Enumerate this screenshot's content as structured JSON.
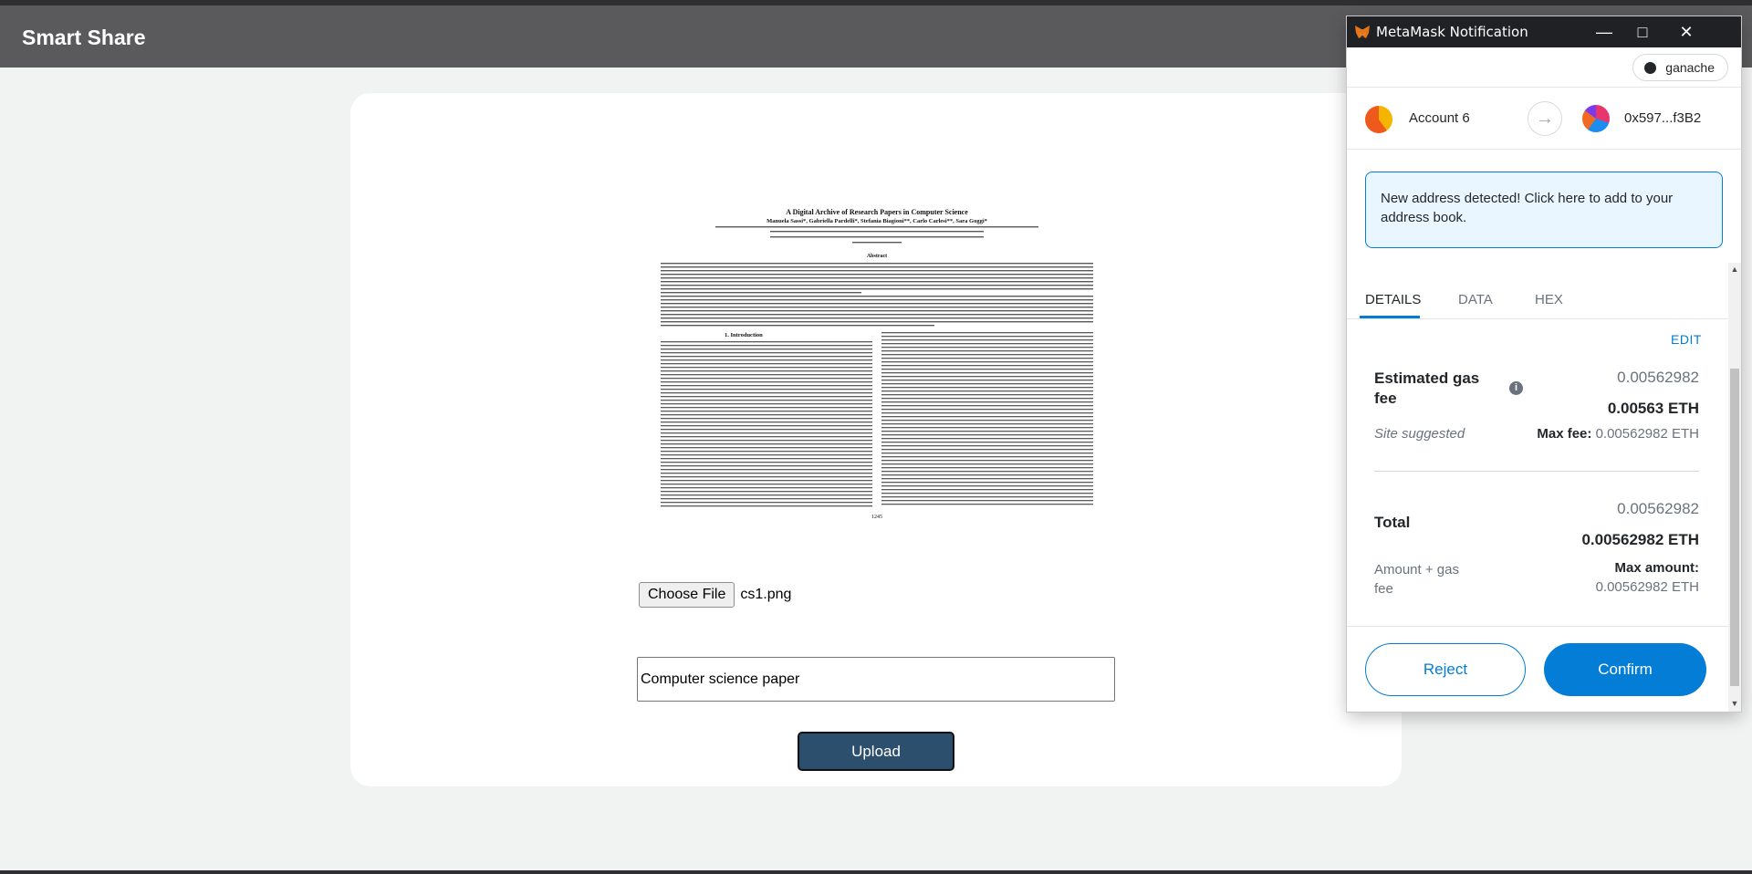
{
  "app": {
    "title": "Smart Share"
  },
  "document_preview": {
    "title": "A Digital Archive of Research Papers in Computer Science",
    "authors": "Manuela Sassi*, Gabriella Pardelli*, Stefania Biagioni**, Carlo Carlesi**, Sara Goggi*",
    "abstract_heading": "Abstract",
    "section_heading": "1.    Introduction",
    "page_number": "1245"
  },
  "form": {
    "choose_file_label": "Choose File",
    "file_name": "cs1.png",
    "description_value": "Computer science paper",
    "upload_label": "Upload"
  },
  "metamask": {
    "window_title": "MetaMask Notification",
    "network": "ganache",
    "from_account": "Account 6",
    "to_address": "0x597...f3B2",
    "notice": "New address detected! Click here to add to your address book.",
    "tabs": [
      "DETAILS",
      "DATA",
      "HEX"
    ],
    "edit_label": "EDIT",
    "gas": {
      "label": "Estimated gas fee",
      "value_secondary": "0.00562982",
      "value_primary": "0.00563 ETH",
      "site_suggested": "Site suggested",
      "max_fee_label": "Max fee:",
      "max_fee_value": "0.00562982 ETH"
    },
    "total": {
      "label": "Total",
      "value_secondary": "0.00562982",
      "value_primary": "0.00562982 ETH",
      "sublabel": "Amount + gas fee",
      "max_amount_label": "Max amount:",
      "max_amount_value": "0.00562982 ETH"
    },
    "reject_label": "Reject",
    "confirm_label": "Confirm",
    "accent_color": "#037dd6"
  }
}
